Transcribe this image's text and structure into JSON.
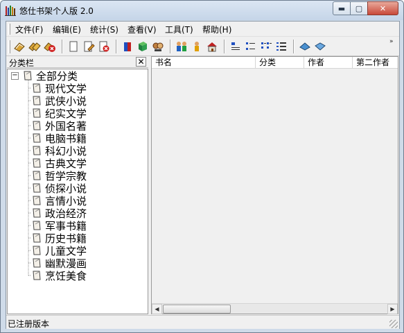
{
  "window": {
    "title": "悠仕书架个人版 2.0",
    "controls": {
      "minimize": "▬",
      "maximize": "▢",
      "close": "✕"
    }
  },
  "menu": [
    {
      "label": "文件(F)"
    },
    {
      "label": "编辑(E)"
    },
    {
      "label": "统计(S)"
    },
    {
      "label": "查看(V)"
    },
    {
      "label": "工具(T)"
    },
    {
      "label": "帮助(H)"
    }
  ],
  "toolbar": {
    "buttons": [
      {
        "icon": "open-book-icon"
      },
      {
        "icon": "books-icon"
      },
      {
        "icon": "delete-book-icon"
      },
      {
        "icon": "blank-page-icon"
      },
      {
        "icon": "edit-page-icon"
      },
      {
        "icon": "delete-page-icon"
      },
      {
        "icon": "book-spine-red-icon"
      },
      {
        "icon": "book-green-icon"
      },
      {
        "icon": "search-people-icon"
      },
      {
        "icon": "group-icon"
      },
      {
        "icon": "person-icon"
      },
      {
        "icon": "house-icon"
      },
      {
        "icon": "large-icons-view-icon"
      },
      {
        "icon": "small-icons-view-icon"
      },
      {
        "icon": "list-view-icon"
      },
      {
        "icon": "details-view-icon"
      },
      {
        "icon": "back-icon"
      },
      {
        "icon": "forward-icon"
      }
    ],
    "overflow": "»"
  },
  "sidebar": {
    "title": "分类栏",
    "close": "✕",
    "root": {
      "label": "全部分类",
      "expander": "−"
    },
    "categories": [
      "现代文学",
      "武侠小说",
      "纪实文学",
      "外国名著",
      "电脑书籍",
      "科幻小说",
      "古典文学",
      "哲学宗教",
      "侦探小说",
      "言情小说",
      "政治经济",
      "军事书籍",
      "历史书籍",
      "儿童文学",
      "幽默漫画",
      "烹饪美食"
    ]
  },
  "list": {
    "columns": [
      "书名",
      "分类",
      "作者",
      "第二作者"
    ],
    "scroll": {
      "left": "◀",
      "right": "▶"
    }
  },
  "status": {
    "text": "已注册版本"
  }
}
